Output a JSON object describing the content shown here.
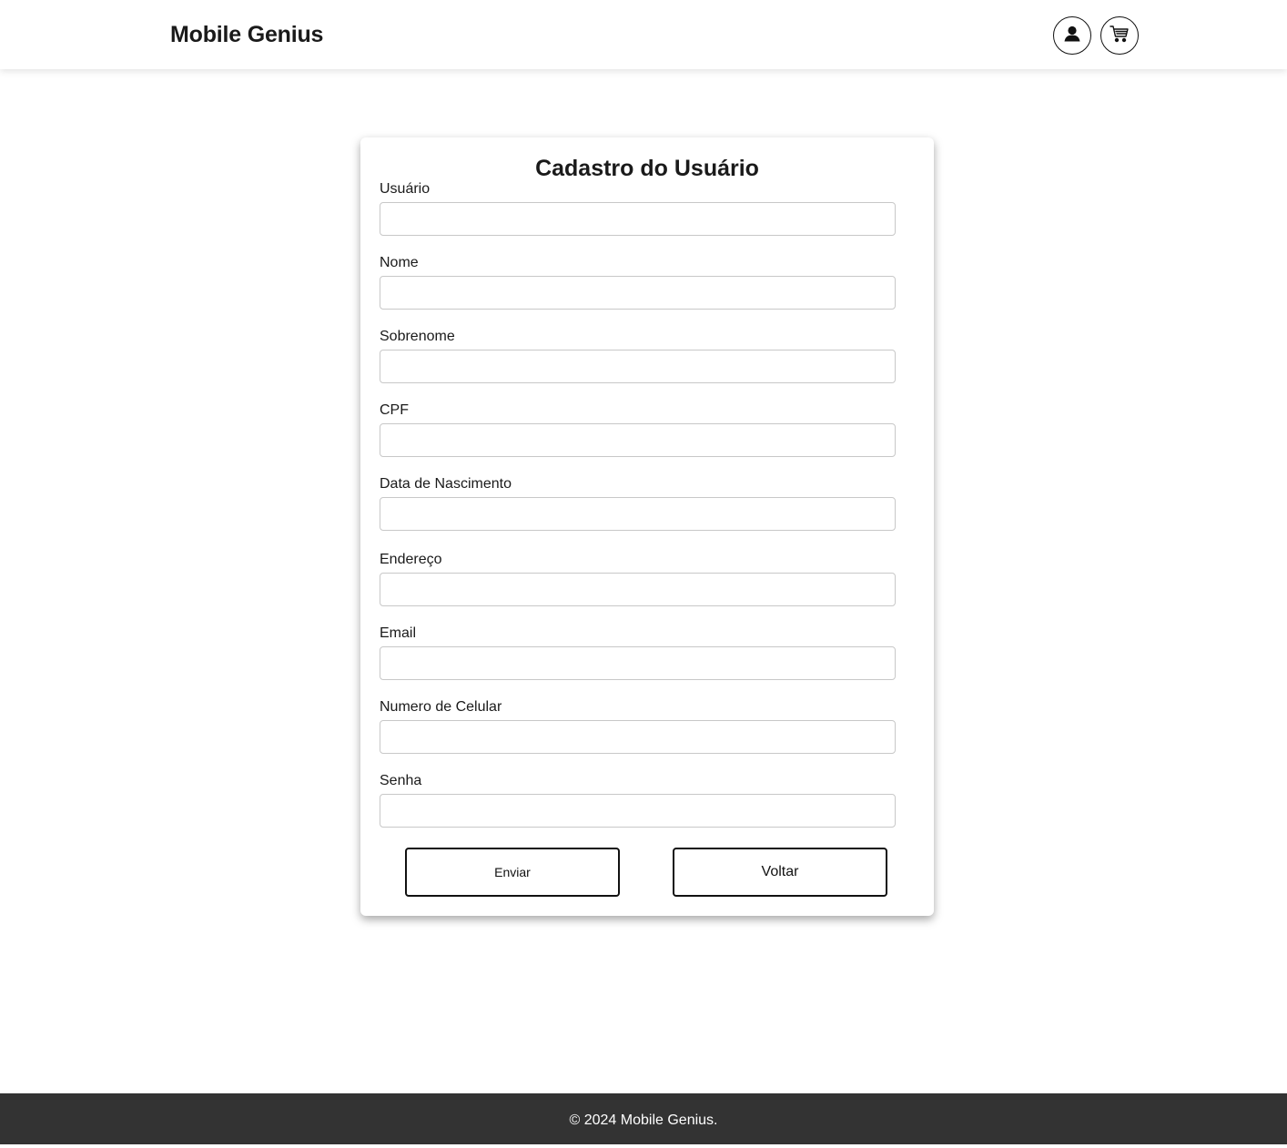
{
  "header": {
    "brand": "Mobile Genius",
    "icons": [
      "user-icon",
      "cart-icon"
    ]
  },
  "form": {
    "title": "Cadastro do Usuário",
    "fields": [
      {
        "label": "Usuário",
        "value": "",
        "placeholder": ""
      },
      {
        "label": "Nome",
        "value": "",
        "placeholder": ""
      },
      {
        "label": "Sobrenome",
        "value": "",
        "placeholder": ""
      },
      {
        "label": "CPF",
        "value": "",
        "placeholder": ""
      },
      {
        "label": "Data de Nascimento",
        "value": "",
        "placeholder": ""
      },
      {
        "label": "Endereço",
        "value": "",
        "placeholder": ""
      },
      {
        "label": "Email",
        "value": "",
        "placeholder": ""
      },
      {
        "label": "Numero de Celular",
        "value": "",
        "placeholder": ""
      },
      {
        "label": "Senha",
        "value": "",
        "placeholder": ""
      }
    ],
    "submit_label": "Enviar",
    "back_label": "Voltar"
  },
  "footer": {
    "text": "© 2024 Mobile Genius."
  },
  "colors": {
    "footer_bg": "#333333",
    "page_bg": "#ffffff",
    "text": "#1a1a1a"
  }
}
